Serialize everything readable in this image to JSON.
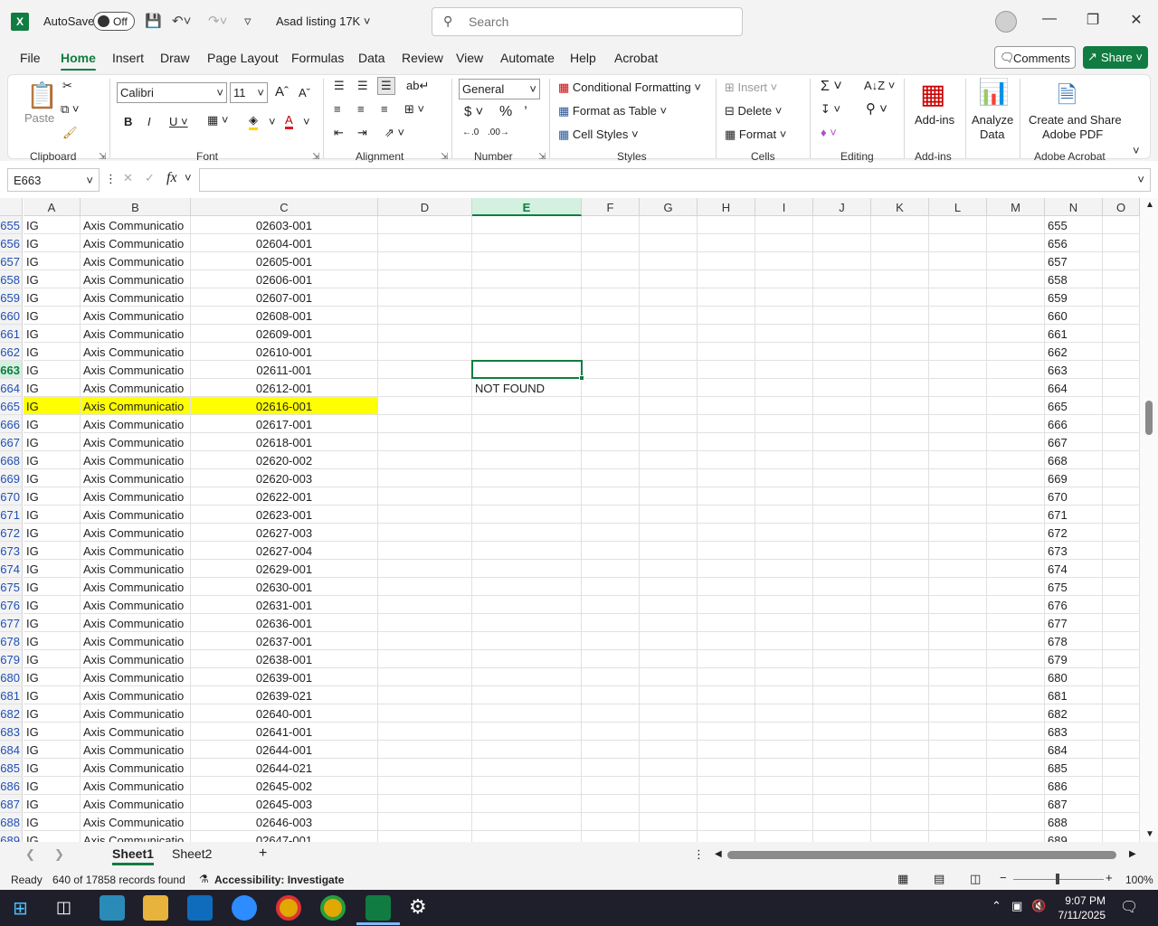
{
  "titlebar": {
    "autosave_label": "AutoSave",
    "autosave_state": "Off",
    "file_title": "Asad listing 17K",
    "search_placeholder": "Search"
  },
  "menu": {
    "tabs": [
      "File",
      "Home",
      "Insert",
      "Draw",
      "Page Layout",
      "Formulas",
      "Data",
      "Review",
      "View",
      "Automate",
      "Help",
      "Acrobat"
    ],
    "active_tab": "Home",
    "comments_label": "Comments",
    "share_label": "Share"
  },
  "ribbon": {
    "clipboard": {
      "label": "Clipboard",
      "paste": "Paste"
    },
    "font": {
      "label": "Font",
      "name": "Calibri",
      "size": "11"
    },
    "alignment": {
      "label": "Alignment"
    },
    "number": {
      "label": "Number",
      "format": "General"
    },
    "styles": {
      "label": "Styles",
      "conditional": "Conditional Formatting",
      "format_table": "Format as Table",
      "cell_styles": "Cell Styles"
    },
    "cells": {
      "label": "Cells",
      "insert": "Insert",
      "delete": "Delete",
      "format": "Format"
    },
    "editing": {
      "label": "Editing"
    },
    "addins": {
      "label": "Add-ins",
      "button": "Add-ins"
    },
    "analyze": {
      "line1": "Analyze",
      "line2": "Data"
    },
    "acrobat": {
      "label": "Adobe Acrobat",
      "line1": "Create and Share",
      "line2": "Adobe PDF"
    }
  },
  "formula_bar": {
    "name_box": "E663",
    "fx": "fx",
    "formula": ""
  },
  "columns": [
    "A",
    "B",
    "C",
    "D",
    "E",
    "F",
    "G",
    "H",
    "I",
    "J",
    "K",
    "L",
    "M",
    "N",
    "O"
  ],
  "selected_column": "E",
  "rows": [
    {
      "n": "655",
      "a": "IG",
      "b": "Axis Communicatio",
      "c": "02603-001"
    },
    {
      "n": "656",
      "a": "IG",
      "b": "Axis Communicatio",
      "c": "02604-001"
    },
    {
      "n": "657",
      "a": "IG",
      "b": "Axis Communicatio",
      "c": "02605-001"
    },
    {
      "n": "658",
      "a": "IG",
      "b": "Axis Communicatio",
      "c": "02606-001"
    },
    {
      "n": "659",
      "a": "IG",
      "b": "Axis Communicatio",
      "c": "02607-001"
    },
    {
      "n": "660",
      "a": "IG",
      "b": "Axis Communicatio",
      "c": "02608-001"
    },
    {
      "n": "661",
      "a": "IG",
      "b": "Axis Communicatio",
      "c": "02609-001"
    },
    {
      "n": "662",
      "a": "IG",
      "b": "Axis Communicatio",
      "c": "02610-001"
    },
    {
      "n": "663",
      "a": "IG",
      "b": "Axis Communicatio",
      "c": "02611-001"
    },
    {
      "n": "664",
      "a": "IG",
      "b": "Axis Communicatio",
      "c": "02612-001",
      "e": "NOT FOUND"
    },
    {
      "n": "665",
      "a": "IG",
      "b": "Axis Communicatio",
      "c": "02616-001",
      "highlight": true
    },
    {
      "n": "666",
      "a": "IG",
      "b": "Axis Communicatio",
      "c": "02617-001"
    },
    {
      "n": "667",
      "a": "IG",
      "b": "Axis Communicatio",
      "c": "02618-001"
    },
    {
      "n": "668",
      "a": "IG",
      "b": "Axis Communicatio",
      "c": "02620-002"
    },
    {
      "n": "669",
      "a": "IG",
      "b": "Axis Communicatio",
      "c": "02620-003"
    },
    {
      "n": "670",
      "a": "IG",
      "b": "Axis Communicatio",
      "c": "02622-001"
    },
    {
      "n": "671",
      "a": "IG",
      "b": "Axis Communicatio",
      "c": "02623-001"
    },
    {
      "n": "672",
      "a": "IG",
      "b": "Axis Communicatio",
      "c": "02627-003"
    },
    {
      "n": "673",
      "a": "IG",
      "b": "Axis Communicatio",
      "c": "02627-004"
    },
    {
      "n": "674",
      "a": "IG",
      "b": "Axis Communicatio",
      "c": "02629-001"
    },
    {
      "n": "675",
      "a": "IG",
      "b": "Axis Communicatio",
      "c": "02630-001"
    },
    {
      "n": "676",
      "a": "IG",
      "b": "Axis Communicatio",
      "c": "02631-001"
    },
    {
      "n": "677",
      "a": "IG",
      "b": "Axis Communicatio",
      "c": "02636-001"
    },
    {
      "n": "678",
      "a": "IG",
      "b": "Axis Communicatio",
      "c": "02637-001"
    },
    {
      "n": "679",
      "a": "IG",
      "b": "Axis Communicatio",
      "c": "02638-001"
    },
    {
      "n": "680",
      "a": "IG",
      "b": "Axis Communicatio",
      "c": "02639-001"
    },
    {
      "n": "681",
      "a": "IG",
      "b": "Axis Communicatio",
      "c": "02639-021"
    },
    {
      "n": "682",
      "a": "IG",
      "b": "Axis Communicatio",
      "c": "02640-001"
    },
    {
      "n": "683",
      "a": "IG",
      "b": "Axis Communicatio",
      "c": "02641-001"
    },
    {
      "n": "684",
      "a": "IG",
      "b": "Axis Communicatio",
      "c": "02644-001"
    },
    {
      "n": "685",
      "a": "IG",
      "b": "Axis Communicatio",
      "c": "02644-021"
    },
    {
      "n": "686",
      "a": "IG",
      "b": "Axis Communicatio",
      "c": "02645-002"
    },
    {
      "n": "687",
      "a": "IG",
      "b": "Axis Communicatio",
      "c": "02645-003"
    },
    {
      "n": "688",
      "a": "IG",
      "b": "Axis Communicatio",
      "c": "02646-003"
    },
    {
      "n": "689",
      "a": "IG",
      "b": "Axis Communicatio",
      "c": "02647-001"
    }
  ],
  "active_cell_row": "663",
  "sheets": [
    "Sheet1",
    "Sheet2"
  ],
  "active_sheet": "Sheet1",
  "status": {
    "ready": "Ready",
    "records": "640 of 17858 records found",
    "accessibility": "Accessibility: Investigate",
    "zoom": "100%"
  },
  "taskbar": {
    "time": "9:07 PM",
    "date": "7/11/2025"
  },
  "colors": {
    "accent": "#107c41",
    "highlight": "#ffff00"
  }
}
